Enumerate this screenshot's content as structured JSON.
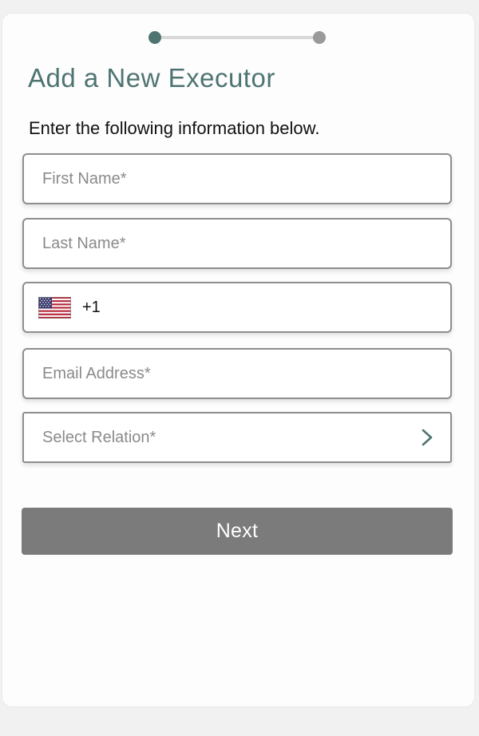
{
  "form": {
    "title": "Add a New Executor",
    "subtitle": "Enter the following information below.",
    "first_name_placeholder": "First Name*",
    "last_name_placeholder": "Last Name*",
    "phone_country_code": "+1",
    "phone_flag_icon": "us-flag-icon",
    "email_placeholder": "Email Address*",
    "relation_placeholder": "Select Relation*",
    "relation_chevron_icon": "chevron-right-icon",
    "next_label": "Next"
  },
  "stepper": {
    "current_step": 1,
    "total_steps": 2
  },
  "colors": {
    "accent": "#4e7472",
    "button_bg": "#7a7b7a",
    "placeholder": "#8a8a8a",
    "border": "#8e8e8e"
  }
}
